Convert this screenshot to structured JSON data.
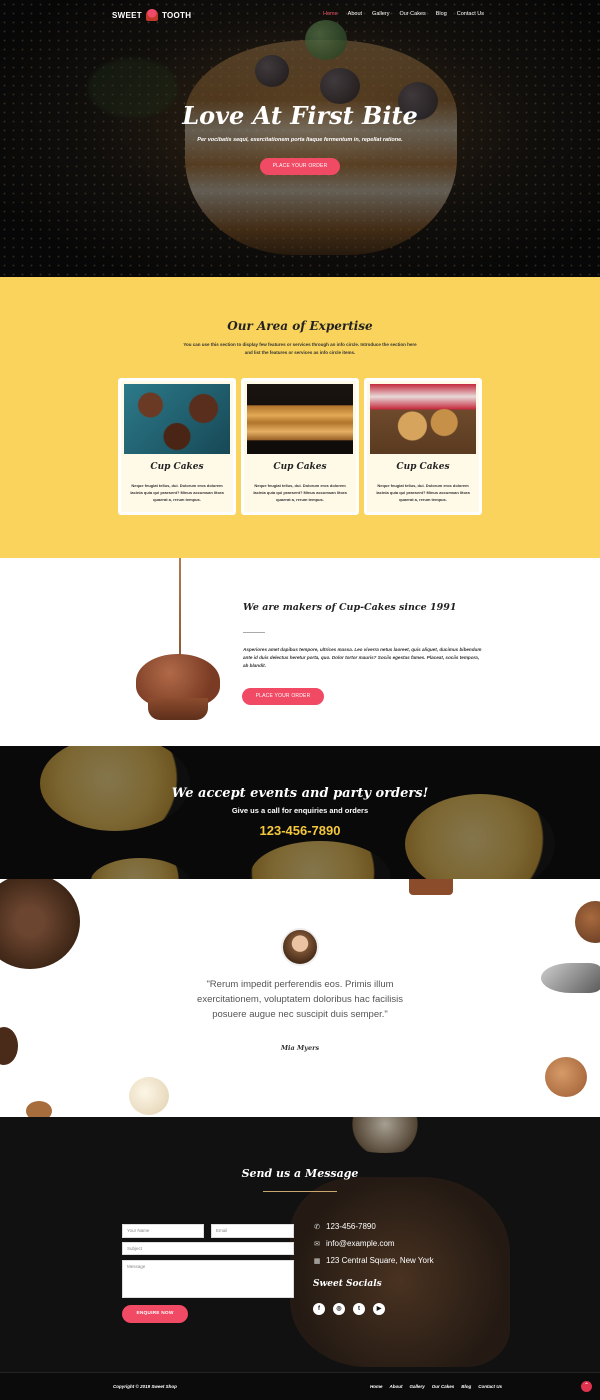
{
  "nav": {
    "logo_left": "SWEET",
    "logo_right": "TOOTH",
    "items": [
      {
        "label": "Home",
        "active": true
      },
      {
        "label": "About"
      },
      {
        "label": "Gallery"
      },
      {
        "label": "Our Cakes"
      },
      {
        "label": "Blog"
      },
      {
        "label": "Contact Us"
      }
    ]
  },
  "hero": {
    "title": "Love At First Bite",
    "subtitle": "Per vocibatis sequi, exercitationem porta Itaque fermentum in, repellat ratione.",
    "cta": "PLACE YOUR ORDER"
  },
  "expertise": {
    "title": "Our Area of Expertise",
    "intro": "You can use this section to display few features or services through an info circle. Introduce the section here and list the features or services as info circle items.",
    "cards": [
      {
        "title": "Cup Cakes",
        "text": "Neque feugiat tellus, dui. Dolorum eros dolorem lacinia quia qui praesent? Minus accumsan litora quaerat a, rerum tempus."
      },
      {
        "title": "Cup Cakes",
        "text": "Neque feugiat tellus, dui. Dolorum eros dolorem lacinia quia qui praesent? Minus accumsan litora quaerat a, rerum tempus."
      },
      {
        "title": "Cup Cakes",
        "text": "Neque feugiat tellus, dui. Dolorum eros dolorem lacinia quia qui praesent? Minus accumsan litora quaerat a, rerum tempus."
      }
    ]
  },
  "makers": {
    "title": "We are makers of Cup-Cakes since 1991",
    "text": "Asperiores amet dapibus tempore, ultrices massa. Leo viverra netus laoreet, quis aliquet, ducimus bibendum ante id duis delectus heretur porta, quo. Dolor tortor mauris? Sociis egestas fames. Placeat, sociis tempora, ab blandit.",
    "cta": "PLACE YOUR ORDER"
  },
  "events": {
    "title": "We accept events and party orders!",
    "subtitle": "Give us a call for enquiries and orders",
    "phone": "123-456-7890"
  },
  "testimonial": {
    "quote": "\"Rerum impedit perferendis eos. Primis illum exercitationem, voluptatem doloribus hac facilisis posuere augue nec suscipit duis semper.\"",
    "author": "Mia Myers"
  },
  "contact": {
    "title": "Send us a Message",
    "form": {
      "name_placeholder": "Your Name",
      "email_placeholder": "Email",
      "subject_placeholder": "Subject",
      "message_placeholder": "Message",
      "submit": "ENQUIRE NOW"
    },
    "phone": "123-456-7890",
    "email": "info@example.com",
    "address": "123 Central Square, New York",
    "socials_title": "Sweet Socials",
    "socials": [
      {
        "icon": "facebook-icon",
        "glyph": "f"
      },
      {
        "icon": "instagram-icon",
        "glyph": "◎"
      },
      {
        "icon": "twitter-icon",
        "glyph": "t"
      },
      {
        "icon": "youtube-icon",
        "glyph": "▶"
      }
    ]
  },
  "footer": {
    "copyright": "Copyright © 2019 Sweet Shop",
    "items": [
      "Home",
      "About",
      "Gallery",
      "Our Cakes",
      "Blog",
      "Contact Us"
    ]
  },
  "colors": {
    "accent": "#f04a64",
    "section_yellow": "#f9d35b",
    "phone_gold": "#f4c73d"
  }
}
